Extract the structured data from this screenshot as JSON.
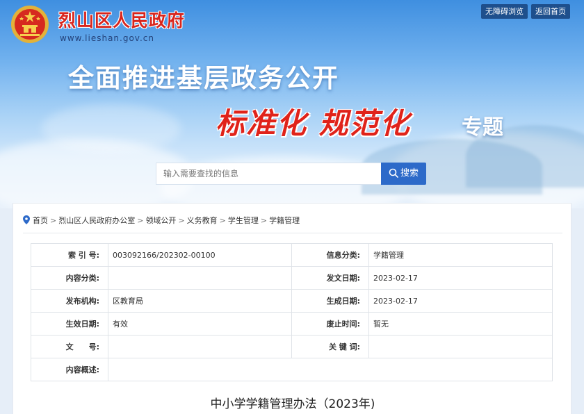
{
  "header": {
    "site_name": "烈山区人民政府",
    "site_url": "www.lieshan.gov.cn",
    "accessibility_btn": "无障碍浏览",
    "home_btn": "返回首页",
    "headline": "全面推进基层政务公开",
    "subheadline_red": "标准化 规范化",
    "subheadline_white": "专题",
    "emblem_icon": "national-emblem-icon"
  },
  "search": {
    "placeholder": "输入需要查找的信息",
    "button_label": "搜索",
    "button_icon": "search-icon"
  },
  "breadcrumb": {
    "icon": "location-pin-icon",
    "items": [
      "首页",
      "烈山区人民政府办公室",
      "领域公开",
      "义务教育",
      "学生管理",
      "学籍管理"
    ],
    "separator": ">"
  },
  "meta": {
    "rows": [
      {
        "l1": "索 引 号:",
        "v1": "003092166/202302-00100",
        "l2": "信息分类:",
        "v2": "学籍管理"
      },
      {
        "l1": "内容分类:",
        "v1": "",
        "l2": "发文日期:",
        "v2": "2023-02-17"
      },
      {
        "l1": "发布机构:",
        "v1": "区教育局",
        "l2": "生成日期:",
        "v2": "2023-02-17"
      },
      {
        "l1": "生效日期:",
        "v1": "有效",
        "l2": "废止时间:",
        "v2": "暂无"
      },
      {
        "l1": "文　　号:",
        "v1": "",
        "l2": "关 键 词:",
        "v2": ""
      }
    ],
    "summary_label": "内容概述:",
    "summary_value": ""
  },
  "document": {
    "title": "中小学学籍管理办法（2023年)"
  },
  "colors": {
    "brand_red": "#d8251d",
    "nav_blue": "#1e4f8c",
    "search_blue": "#2d6ac9"
  }
}
